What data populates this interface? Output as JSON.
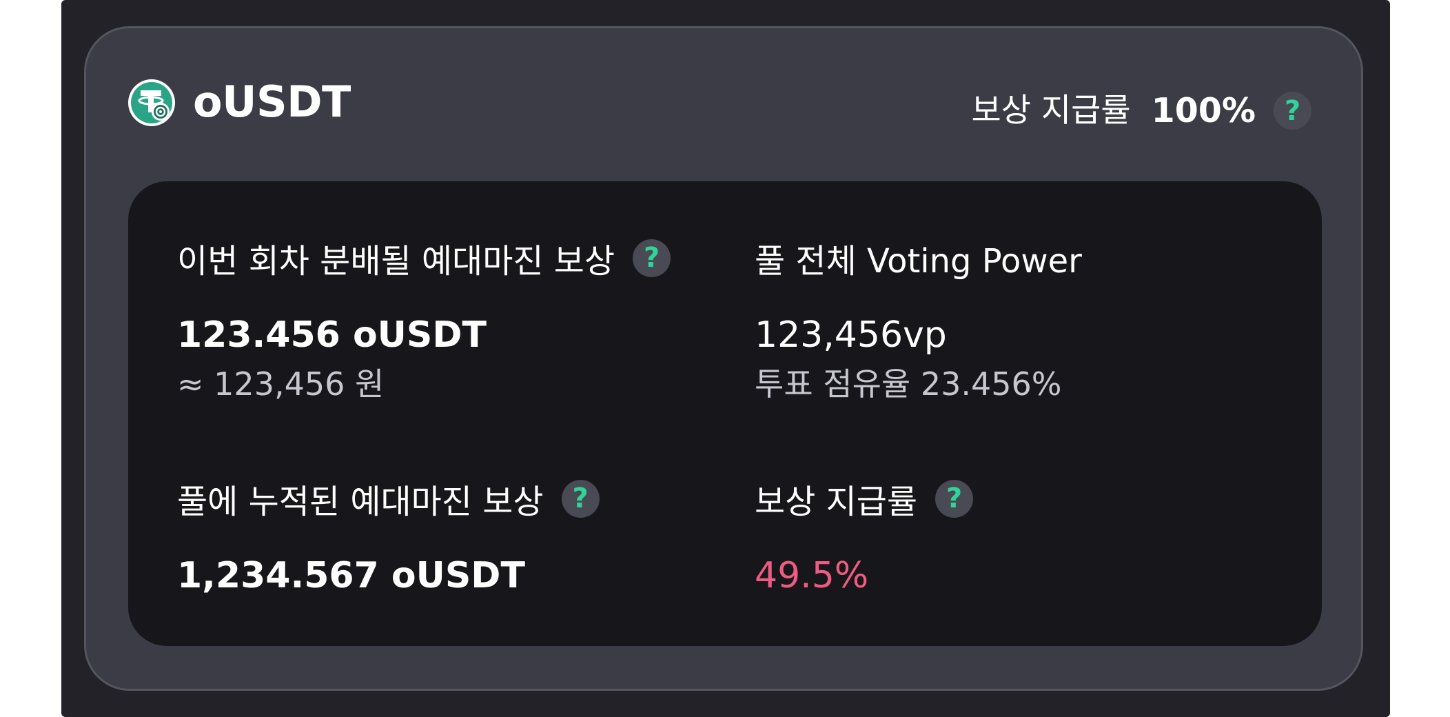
{
  "token": {
    "name": "oUSDT",
    "logo_icon": "ousdt-token-icon",
    "logo_colors": {
      "outer": "#ffffff",
      "main": "#2aa486",
      "ring": "#1a6d5a"
    }
  },
  "header": {
    "payout_rate_label": "보상 지급률",
    "payout_rate_value": "100%"
  },
  "panel": {
    "round_reward": {
      "label": "이번 회차 분배될 예대마진 보상",
      "value": "123.456 oUSDT",
      "sub": "≈ 123,456 원"
    },
    "voting_power": {
      "label": "풀 전체 Voting Power",
      "value": "123,456vp",
      "sub": "투표 점유율 23.456%"
    },
    "accumulated_reward": {
      "label": "풀에 누적된 예대마진 보상",
      "value": "1,234.567 oUSDT"
    },
    "payout_rate": {
      "label": "보상 지급률",
      "value": "49.5%"
    }
  },
  "help_glyph": "?",
  "colors": {
    "accent_green": "#2fd39b",
    "accent_pink": "#ee5c83",
    "card_bg": "#3c3c46",
    "panel_bg": "#17171b"
  }
}
